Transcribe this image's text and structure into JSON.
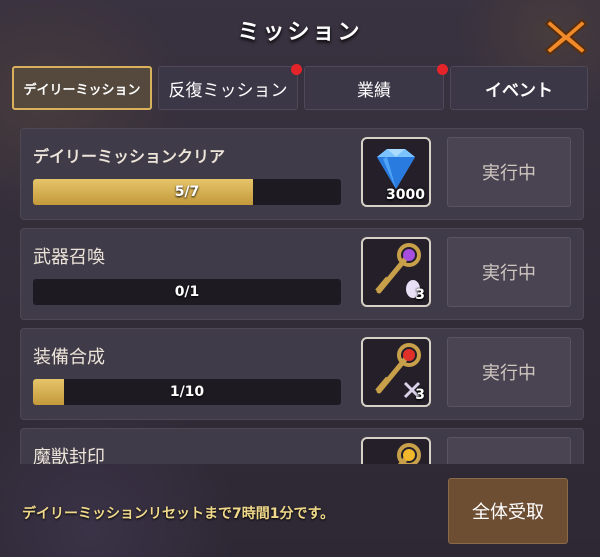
{
  "header": {
    "title": "ミッション"
  },
  "tabs": [
    {
      "label": "デイリーミッション",
      "active": true,
      "badge": false
    },
    {
      "label": "反復ミッション",
      "active": false,
      "badge": true
    },
    {
      "label": "業績",
      "active": false,
      "badge": true
    },
    {
      "label": "イベント",
      "active": false,
      "badge": false
    }
  ],
  "missions": [
    {
      "name": "デイリーミッションクリア",
      "progress_text": "5/7",
      "progress": 0.714,
      "reward_icon": "diamond-icon",
      "reward_count": "3000",
      "status": "実行中"
    },
    {
      "name": "武器召喚",
      "progress_text": "0/1",
      "progress": 0.0,
      "reward_icon": "purple-gem-key-icon",
      "reward_count": "3",
      "status": "実行中"
    },
    {
      "name": "装備合成",
      "progress_text": "1/10",
      "progress": 0.1,
      "reward_icon": "red-gem-key-icon",
      "reward_count": "3",
      "status": "実行中"
    },
    {
      "name": "魔獣封印",
      "reward_icon": "yellow-gem-key-icon"
    }
  ],
  "footer": {
    "reset_text": "デイリーミッションリセットまで7時間1分です。",
    "claim_all_label": "全体受取"
  },
  "colors": {
    "accent": "#d9b15c",
    "badge": "#e5242a",
    "progress": "#d8b458"
  }
}
